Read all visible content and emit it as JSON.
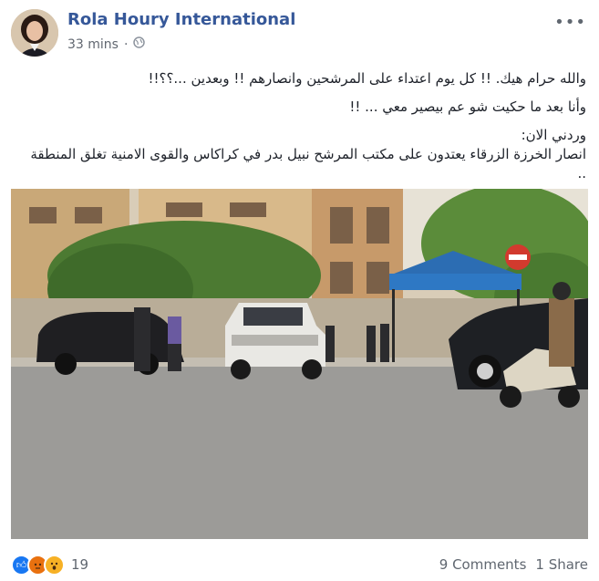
{
  "header": {
    "page_name": "Rola Houry International",
    "timestamp": "33 mins",
    "privacy_icon": "globe-icon",
    "menu_icon": "more-dots-icon"
  },
  "post": {
    "lines": [
      "والله حرام هيك. !! كل يوم اعتداء على المرشحين وانصارهم !! وبعدين ...؟؟!!",
      "وأنا بعد ما حكيت شو عم بيصير معي ... !!",
      "وردني الان:",
      "انصار الخرزة الزرقاء يعتدون على مكتب المرشح نبيل بدر في كراكاس والقوى الامنية تغلق المنطقة .."
    ]
  },
  "reactions": {
    "icons": [
      "like-icon",
      "angry-icon",
      "wow-icon"
    ],
    "count": "19",
    "comments": "9 Comments",
    "shares": "1 Share"
  },
  "colors": {
    "link": "#365899",
    "meta": "#616770",
    "like": "#1877f2",
    "angry": "#e9710f",
    "wow": "#f7b125"
  }
}
